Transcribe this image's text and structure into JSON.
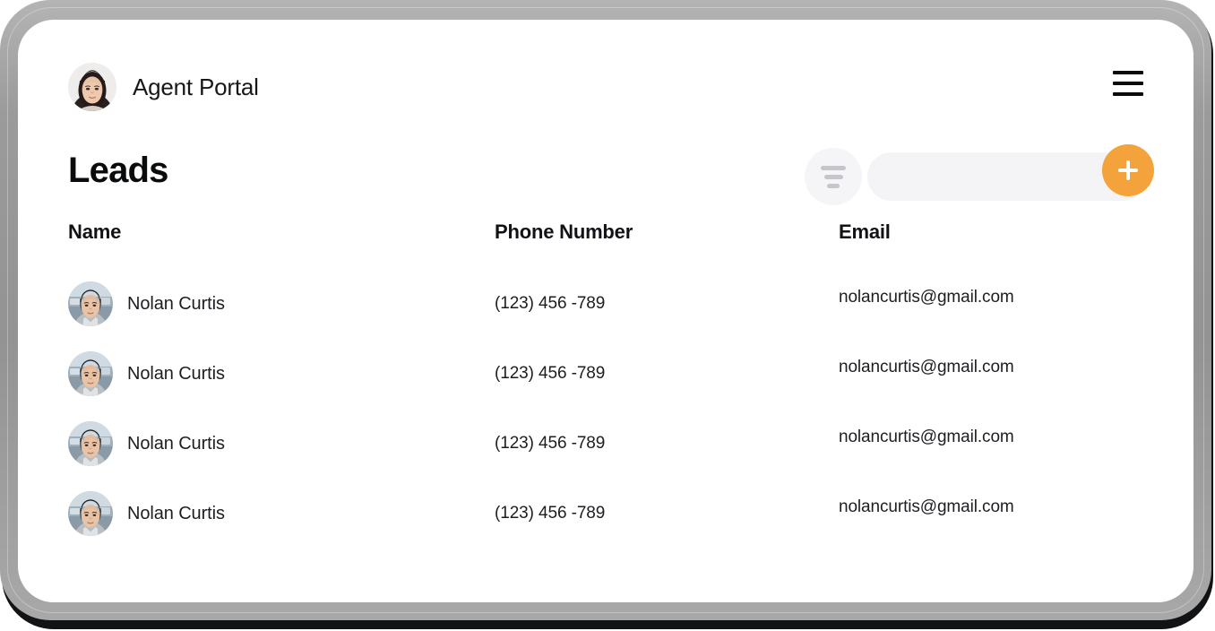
{
  "header": {
    "app_title": "Agent Portal",
    "avatar_name": "user-avatar",
    "menu_icon": "hamburger-menu-icon"
  },
  "toolbar": {
    "page_title": "Leads",
    "filter_icon": "filter-icon",
    "search_value": "",
    "search_placeholder": "",
    "add_label": "+",
    "add_icon": "plus-icon"
  },
  "table": {
    "columns": [
      {
        "key": "name",
        "label": "Name"
      },
      {
        "key": "phone",
        "label": "Phone Number"
      },
      {
        "key": "email",
        "label": "Email"
      }
    ],
    "rows": [
      {
        "name": "Nolan Curtis",
        "phone": "(123) 456 -789",
        "email": "nolancurtis@gmail.com"
      },
      {
        "name": "Nolan Curtis",
        "phone": "(123) 456 -789",
        "email": "nolancurtis@gmail.com"
      },
      {
        "name": "Nolan Curtis",
        "phone": "(123) 456 -789",
        "email": "nolancurtis@gmail.com"
      },
      {
        "name": "Nolan Curtis",
        "phone": "(123) 456 -789",
        "email": "nolancurtis@gmail.com"
      }
    ]
  },
  "colors": {
    "accent": "#f4a23c",
    "text": "#17181a",
    "field_bg": "#f4f4f6",
    "bezel": "#9a9a9a"
  }
}
